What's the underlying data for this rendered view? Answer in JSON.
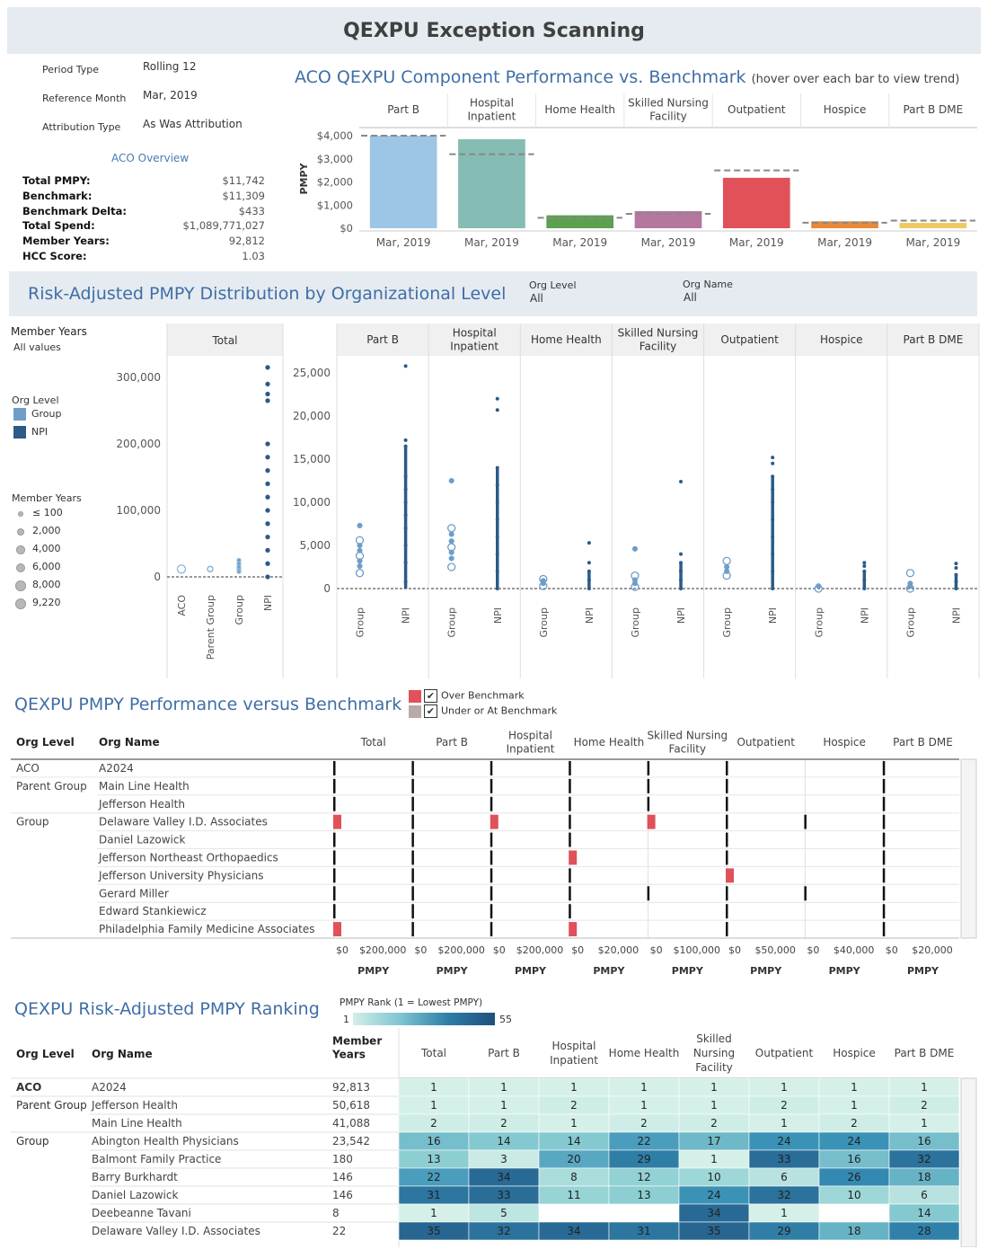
{
  "page_title": "QEXPU Exception Scanning",
  "filters": {
    "period_type_label": "Period Type",
    "period_type_value": "Rolling 12",
    "reference_month_label": "Reference Month",
    "reference_month_value": "Mar, 2019",
    "attribution_type_label": "Attribution Type",
    "attribution_type_value": "As Was Attribution"
  },
  "overview": {
    "heading": "ACO Overview",
    "rows": [
      {
        "label": "Total PMPY:",
        "value": "$11,742"
      },
      {
        "label": "Benchmark:",
        "value": "$11,309"
      },
      {
        "label": "Benchmark Delta:",
        "value": "$433"
      },
      {
        "label": "Total Spend:",
        "value": "$1,089,771,027"
      },
      {
        "label": "Member Years:",
        "value": "92,812"
      },
      {
        "label": "HCC Score:",
        "value": "1.03"
      }
    ]
  },
  "component_chart": {
    "title": "ACO QEXPU Component Performance vs. Benchmark",
    "subtitle": "(hover over each bar to view trend)",
    "ylabel": "PMPY",
    "yticks": [
      "$4,000",
      "$3,000",
      "$2,000",
      "$1,000",
      "$0"
    ],
    "colors": [
      "#9dc6e6",
      "#85bdb4",
      "#5ba14f",
      "#b5779f",
      "#e0515a",
      "#e8893a",
      "#efc860"
    ],
    "benchmark_color": "#888888"
  },
  "distribution": {
    "title": "Risk-Adjusted PMPY Distribution by Organizational Level",
    "org_level_label": "Org Level",
    "org_level_value": "All",
    "org_name_label": "Org Name",
    "org_name_value": "All",
    "member_years_label": "Member Years",
    "member_years_value": "All values",
    "legend_org_level_title": "Org Level",
    "legend_org_levels": [
      {
        "label": "Group",
        "color": "#6f9dc8"
      },
      {
        "label": "NPI",
        "color": "#2b5b88"
      }
    ],
    "legend_size_title": "Member Years",
    "legend_sizes": [
      "≤ 100",
      "2,000",
      "4,000",
      "6,000",
      "8,000",
      "9,220"
    ],
    "total_header": "Total",
    "total_yticks": [
      "300,000",
      "200,000",
      "100,000",
      "0"
    ],
    "total_xcats": [
      "ACO",
      "Parent Group",
      "Group",
      "NPI"
    ],
    "component_yticks": [
      "25,000",
      "20,000",
      "15,000",
      "10,000",
      "5,000",
      "0"
    ],
    "component_xcats": [
      "Group",
      "NPI"
    ]
  },
  "performance": {
    "title": "QEXPU PMPY Performance versus Benchmark",
    "legend": [
      {
        "label": "Over Benchmark",
        "color": "#e0515a"
      },
      {
        "label": "Under or At Benchmark",
        "color": "#b7aaa8"
      }
    ],
    "col_org_level": "Org Level",
    "col_org_name": "Org Name",
    "columns": [
      {
        "name": "Total",
        "ticks": [
          "$0",
          "$200,000"
        ]
      },
      {
        "name": "Part B",
        "ticks": [
          "$0",
          "$200,000"
        ]
      },
      {
        "name": "Hospital\nInpatient",
        "ticks": [
          "$0",
          "$200,000"
        ]
      },
      {
        "name": "Home Health",
        "ticks": [
          "$0",
          "$20,000"
        ]
      },
      {
        "name": "Skilled Nursing\nFacility",
        "ticks": [
          "$0",
          "$100,000"
        ]
      },
      {
        "name": "Outpatient",
        "ticks": [
          "$0",
          "$50,000"
        ]
      },
      {
        "name": "Hospice",
        "ticks": [
          "$0",
          "$40,000"
        ]
      },
      {
        "name": "Part B DME",
        "ticks": [
          "$0",
          "$20,000"
        ]
      }
    ],
    "axis_label": "PMPY",
    "rows": [
      {
        "level": "ACO",
        "name": "A2024"
      },
      {
        "level": "Parent Group",
        "name": "Main Line Health"
      },
      {
        "level": "",
        "name": "Jefferson Health"
      },
      {
        "level": "Group",
        "name": "Delaware Valley I.D. Associates"
      },
      {
        "level": "",
        "name": "Daniel Lazowick"
      },
      {
        "level": "",
        "name": "Jefferson Northeast Orthopaedics"
      },
      {
        "level": "",
        "name": "Jefferson University Physicians"
      },
      {
        "level": "",
        "name": "Gerard Miller"
      },
      {
        "level": "",
        "name": "Edward Stankiewicz"
      },
      {
        "level": "",
        "name": "Philadelphia Family Medicine Associates"
      }
    ]
  },
  "ranking": {
    "title": "QEXPU Risk-Adjusted PMPY Ranking",
    "legend_title": "PMPY Rank (1 = Lowest PMPY)",
    "legend_min": "1",
    "legend_max": "55",
    "col_org_level": "Org Level",
    "col_org_name": "Org Name",
    "col_member_years": "Member\nYears",
    "columns": [
      "Total",
      "Part B",
      "Hospital\nInpatient",
      "Home Health",
      "Skilled\nNursing\nFacility",
      "Outpatient",
      "Hospice",
      "Part B DME"
    ],
    "rows": [
      {
        "level": "ACO",
        "name": "A2024",
        "my": "92,813",
        "ranks": [
          1,
          1,
          1,
          1,
          1,
          1,
          1,
          1
        ]
      },
      {
        "level": "Parent Group",
        "name": "Jefferson Health",
        "my": "50,618",
        "ranks": [
          1,
          1,
          2,
          1,
          1,
          2,
          1,
          2
        ]
      },
      {
        "level": "",
        "name": "Main Line Health",
        "my": "41,088",
        "ranks": [
          2,
          2,
          1,
          2,
          2,
          1,
          2,
          1
        ]
      },
      {
        "level": "Group",
        "name": "Abington Health Physicians",
        "my": "23,542",
        "ranks": [
          16,
          14,
          14,
          22,
          17,
          24,
          24,
          16
        ]
      },
      {
        "level": "",
        "name": "Balmont Family Practice",
        "my": "180",
        "ranks": [
          13,
          3,
          20,
          29,
          1,
          33,
          16,
          32
        ]
      },
      {
        "level": "",
        "name": "Barry Burkhardt",
        "my": "146",
        "ranks": [
          22,
          34,
          8,
          12,
          10,
          6,
          26,
          18
        ]
      },
      {
        "level": "",
        "name": "Daniel Lazowick",
        "my": "146",
        "ranks": [
          31,
          33,
          11,
          13,
          24,
          32,
          10,
          6
        ]
      },
      {
        "level": "",
        "name": "Deebeanne Tavani",
        "my": "8",
        "ranks": [
          1,
          5,
          null,
          null,
          34,
          1,
          null,
          14
        ]
      },
      {
        "level": "",
        "name": "Delaware Valley I.D. Associates",
        "my": "22",
        "ranks": [
          35,
          32,
          34,
          31,
          35,
          29,
          18,
          28
        ]
      }
    ]
  },
  "chart_data": [
    {
      "type": "bar",
      "title": "ACO QEXPU Component Performance vs. Benchmark",
      "categories": [
        "Part B",
        "Hospital Inpatient",
        "Home Health",
        "Skilled Nursing Facility",
        "Outpatient",
        "Hospice",
        "Part B DME"
      ],
      "x_label_each": "Mar, 2019",
      "ylabel": "PMPY",
      "ylim": [
        0,
        4200
      ],
      "series": [
        {
          "name": "PMPY",
          "values": [
            4000,
            3850,
            560,
            740,
            2180,
            300,
            230
          ]
        },
        {
          "name": "Benchmark",
          "values": [
            4000,
            3200,
            450,
            620,
            2500,
            240,
            330
          ]
        }
      ],
      "grid": false
    },
    {
      "type": "scatter",
      "title": "Risk-Adjusted PMPY Distribution by Organizational Level",
      "panels": [
        {
          "name": "Total",
          "ylim": [
            0,
            320000
          ],
          "cats": [
            "ACO",
            "Parent Group",
            "Group",
            "NPI"
          ],
          "points": {
            "ACO": [
              11742
            ],
            "Parent Group": [
              11500,
              12000
            ],
            "Group": [
              8000,
              12000,
              15000,
              20000,
              25000
            ],
            "NPI": [
              0,
              20000,
              40000,
              60000,
              80000,
              100000,
              120000,
              140000,
              160000,
              180000,
              200000,
              265000,
              275000,
              290000,
              315000
            ]
          }
        },
        {
          "name": "Part B",
          "ylim": [
            0,
            26000
          ],
          "points": {
            "Group": [
              1800,
              2600,
              3200,
              3800,
              4400,
              5000,
              5600,
              7300
            ],
            "NPI": [
              800,
              3000,
              5000,
              7000,
              8500,
              10000,
              11500,
              13000,
              16500,
              17200,
              25800
            ]
          }
        },
        {
          "name": "Hospital Inpatient",
          "ylim": [
            0,
            26000
          ],
          "points": {
            "Group": [
              2500,
              3500,
              4200,
              4800,
              5500,
              6300,
              7000,
              12500
            ],
            "NPI": [
              0,
              2000,
              4000,
              6000,
              8000,
              10000,
              12000,
              14000,
              20700,
              22000
            ]
          }
        },
        {
          "name": "Home Health",
          "ylim": [
            0,
            26000
          ],
          "points": {
            "Group": [
              300,
              600,
              900,
              1100
            ],
            "NPI": [
              0,
              1000,
              2000,
              3000,
              5300
            ]
          }
        },
        {
          "name": "Skilled Nursing Facility",
          "ylim": [
            0,
            26000
          ],
          "points": {
            "Group": [
              200,
              600,
              1000,
              1500,
              4600
            ],
            "NPI": [
              0,
              1000,
              2000,
              3000,
              4000,
              12400
            ]
          }
        },
        {
          "name": "Outpatient",
          "ylim": [
            0,
            26000
          ],
          "points": {
            "Group": [
              1500,
              2000,
              2500,
              3200
            ],
            "NPI": [
              0,
              2000,
              4000,
              6000,
              8000,
              10000,
              11500,
              13000,
              14500,
              15200
            ]
          }
        },
        {
          "name": "Hospice",
          "ylim": [
            0,
            26000
          ],
          "points": {
            "Group": [
              0,
              300
            ],
            "NPI": [
              0,
              1000,
              2000,
              2600,
              3000
            ]
          }
        },
        {
          "name": "Part B DME",
          "ylim": [
            0,
            26000
          ],
          "points": {
            "Group": [
              0,
              300,
              600,
              1800
            ],
            "NPI": [
              0,
              800,
              1600,
              2400,
              2900
            ]
          }
        }
      ]
    }
  ]
}
